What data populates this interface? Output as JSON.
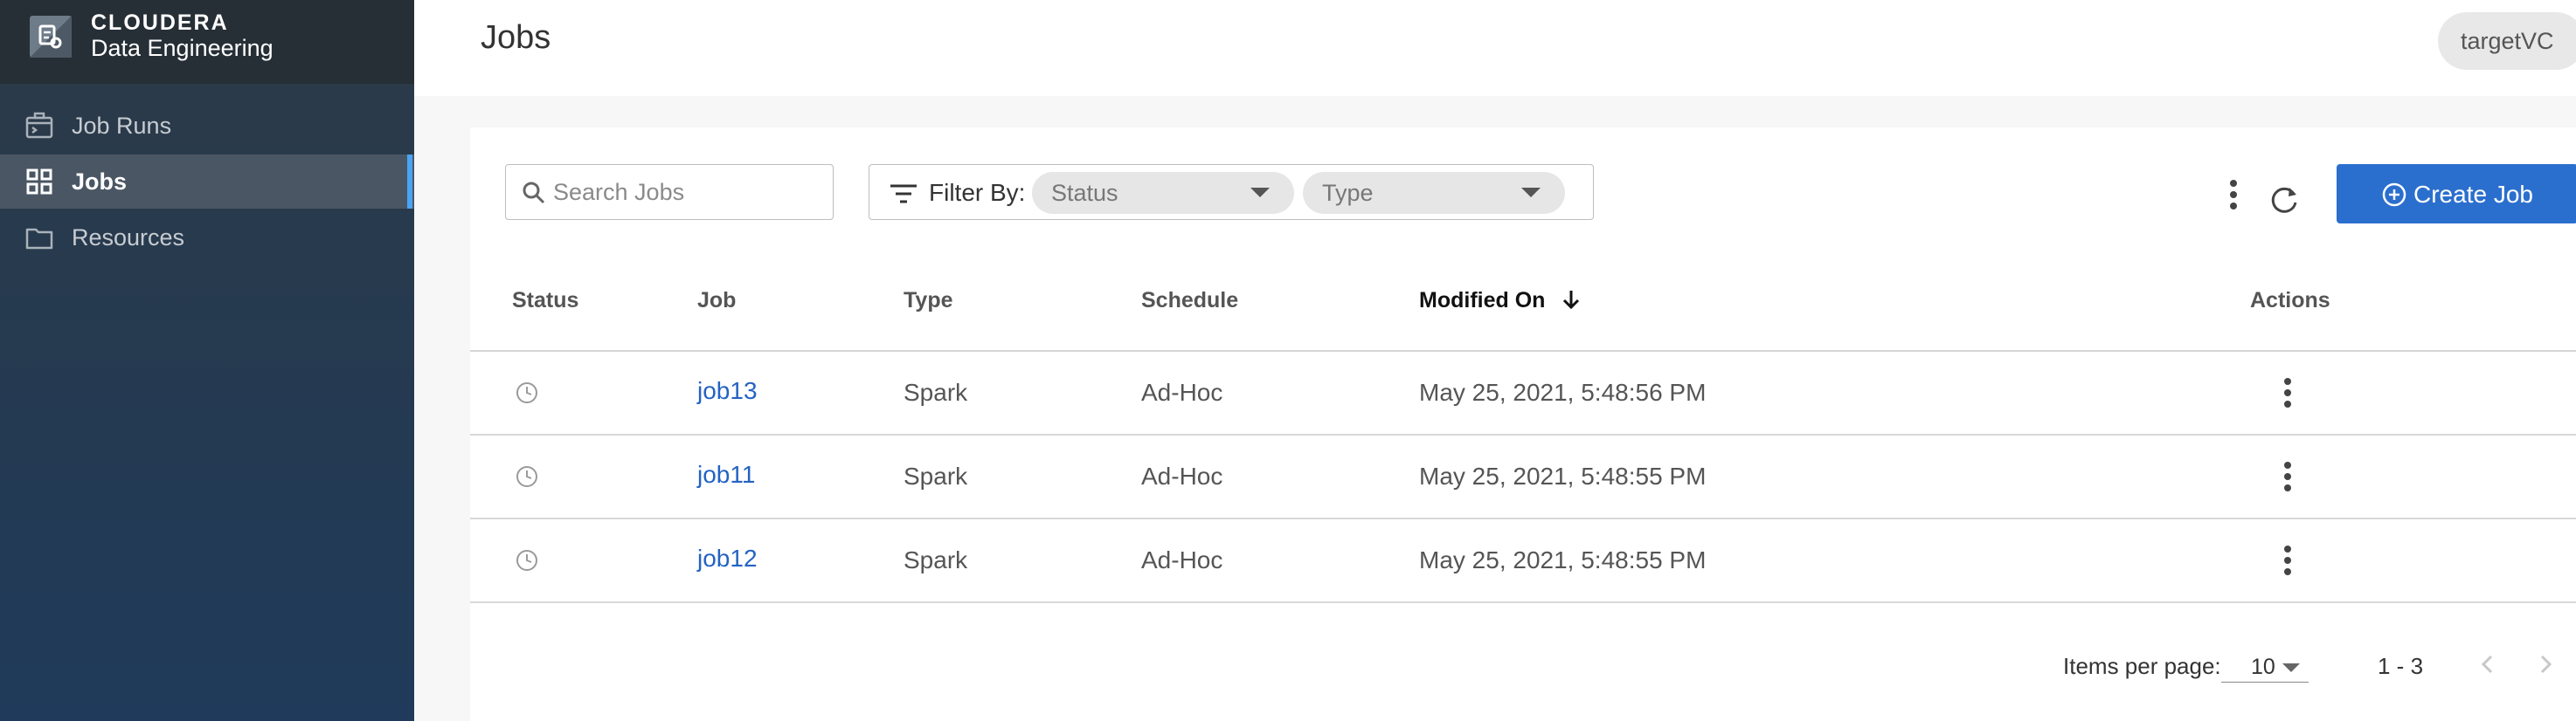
{
  "brand": {
    "title": "CLOUDERA",
    "subtitle": "Data Engineering"
  },
  "sidebar": {
    "items": [
      {
        "label": "Job Runs",
        "icon": "terminal-icon",
        "active": false
      },
      {
        "label": "Jobs",
        "icon": "grid-icon",
        "active": true
      },
      {
        "label": "Resources",
        "icon": "folder-icon",
        "active": false
      }
    ]
  },
  "header": {
    "title": "Jobs",
    "user": "targetVC"
  },
  "toolbar": {
    "search_placeholder": "Search Jobs",
    "filter_label": "Filter By:",
    "status_placeholder": "Status",
    "type_placeholder": "Type",
    "create_label": "Create Job"
  },
  "table": {
    "columns": [
      "Status",
      "Job",
      "Type",
      "Schedule",
      "Modified On",
      "Actions"
    ],
    "sorted_column": "Modified On",
    "rows": [
      {
        "status_icon": "clock-icon",
        "job": "job13",
        "type": "Spark",
        "schedule": "Ad-Hoc",
        "modified": "May 25, 2021, 5:48:56 PM"
      },
      {
        "status_icon": "clock-icon",
        "job": "job11",
        "type": "Spark",
        "schedule": "Ad-Hoc",
        "modified": "May 25, 2021, 5:48:55 PM"
      },
      {
        "status_icon": "clock-icon",
        "job": "job12",
        "type": "Spark",
        "schedule": "Ad-Hoc",
        "modified": "May 25, 2021, 5:48:55 PM"
      }
    ]
  },
  "pagination": {
    "items_per_page_label": "Items per page:",
    "items_per_page": "10",
    "range": "1 - 3"
  },
  "colors": {
    "primary": "#2b6fce",
    "link": "#2463c2",
    "active_accent": "#4aa4f3"
  }
}
